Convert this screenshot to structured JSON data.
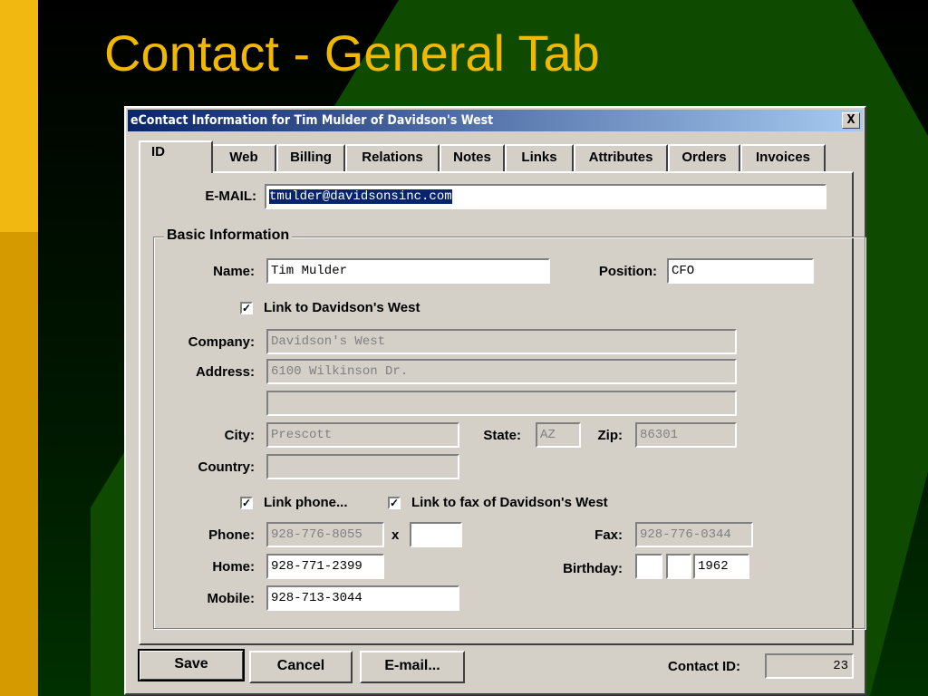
{
  "slide": {
    "title": "Contact - General Tab"
  },
  "dialog": {
    "title": "eContact Information for Tim Mulder of Davidson's West",
    "close": "X"
  },
  "tabs": [
    "ID",
    "Web",
    "Billing",
    "Relations",
    "Notes",
    "Links",
    "Attributes",
    "Orders",
    "Invoices"
  ],
  "email": {
    "label": "E-MAIL:",
    "value": "tmulder@davidsonsinc.com"
  },
  "basic": {
    "title": "Basic Information",
    "name_label": "Name:",
    "name": "Tim Mulder",
    "position_label": "Position:",
    "position": "CFO",
    "link_company": "Link to Davidson's West",
    "company_label": "Company:",
    "company": "Davidson's West",
    "address_label": "Address:",
    "address1": "6100 Wilkinson Dr.",
    "address2": "",
    "city_label": "City:",
    "city": "Prescott",
    "state_label": "State:",
    "state": "AZ",
    "zip_label": "Zip:",
    "zip": "86301",
    "country_label": "Country:",
    "country": "",
    "link_phone": "Link phone...",
    "link_fax": "Link to fax of Davidson's West",
    "phone_label": "Phone:",
    "phone": "928-776-8055",
    "ext_label": "x",
    "ext": "",
    "fax_label": "Fax:",
    "fax": "928-776-0344",
    "home_label": "Home:",
    "home": "928-771-2399",
    "birthday_label": "Birthday:",
    "bday_month": "",
    "bday_day": "",
    "bday_year": "1962",
    "mobile_label": "Mobile:",
    "mobile": "928-713-3044"
  },
  "footer": {
    "save": "Save",
    "cancel": "Cancel",
    "email": "E-mail...",
    "contact_id_label": "Contact ID:",
    "contact_id": "23"
  }
}
